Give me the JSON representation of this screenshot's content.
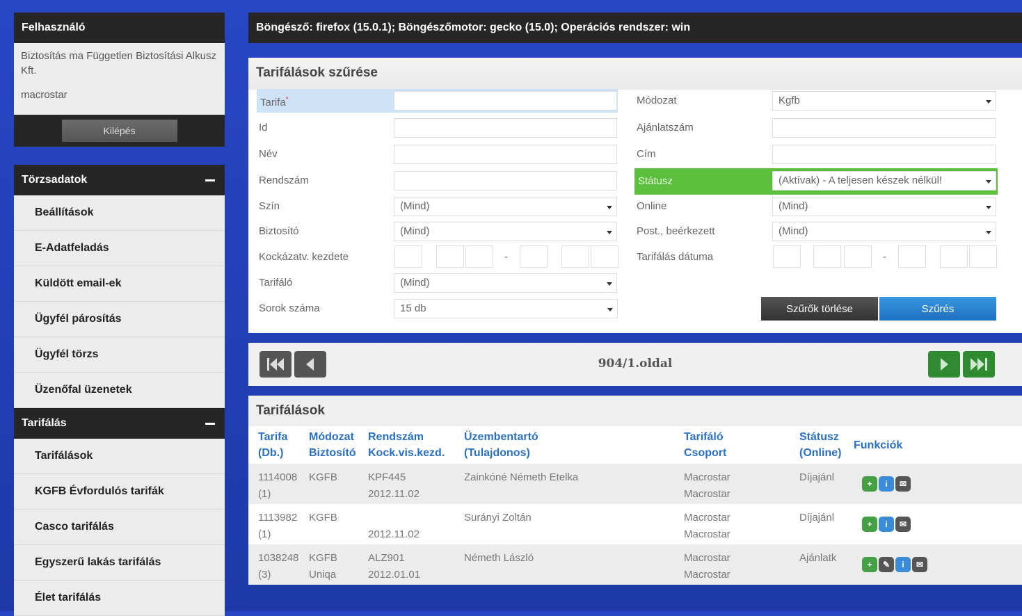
{
  "user_panel": {
    "title": "Felhasználó",
    "company": "Biztosítás ma Független Biztosítási Alkusz Kft.",
    "username": "macrostar",
    "logout_label": "Kilépés"
  },
  "sections": [
    {
      "title": "Törzsadatok",
      "items": [
        "Beállítások",
        "E-Adatfeladás",
        "Küldött email-ek",
        "Ügyfél párosítás",
        "Ügyfél törzs",
        "Üzenőfal üzenetek"
      ]
    },
    {
      "title": "Tarifálás",
      "items": [
        "Tarifálások",
        "KGFB Évfordulós tarifák",
        "Casco tarifálás",
        "Egyszerű lakás tarifálás",
        "Élet tarifálás"
      ]
    }
  ],
  "browser_info": "Böngésző: firefox (15.0.1); Böngészőmotor: gecko (15.0); Operációs rendszer: win",
  "filter": {
    "title": "Tarifálások szűrése",
    "labels": {
      "tarifa": "Tarifa",
      "required_mark": "*",
      "id": "Id",
      "nev": "Név",
      "rendszam": "Rendszám",
      "szin": "Szín",
      "biztosito": "Biztosító",
      "kockazat": "Kockázatv. kezdete",
      "tarifalo": "Tarifáló",
      "sorok": "Sorok száma",
      "modozat": "Módozat",
      "ajanlatszam": "Ajánlatszám",
      "cim": "Cím",
      "statusz": "Státusz",
      "online": "Online",
      "post": "Post., beérkezett",
      "tarifalas_datuma": "Tarifálás dátuma"
    },
    "values": {
      "szin": "(Mind)",
      "biztosito": "(Mind)",
      "tarifalo": "(Mind)",
      "sorok": "15 db",
      "modozat": "Kgfb",
      "statusz": "(Aktívak) - A teljesen készek nélkül!",
      "online": "(Mind)",
      "post": "(Mind)"
    },
    "clear_label": "Szűrők törlése",
    "filter_label": "Szűrés",
    "colors": {
      "focus": "#cfe3f8",
      "status_highlight": "#5cbf3d",
      "primary": "#2a7fd4"
    }
  },
  "pager": {
    "info": "904/1.oldal"
  },
  "list": {
    "title": "Tarifálások",
    "headers": [
      [
        "Tarifa",
        "(Db.)"
      ],
      [
        "Módozat",
        "Biztosító"
      ],
      [
        "Rendszám",
        "Kock.vis.kezd."
      ],
      [
        "Üzembentartó",
        "(Tulajdonos)"
      ],
      [
        "Tarifáló",
        "Csoport"
      ],
      [
        "Státusz",
        "(Online)"
      ],
      [
        "Funkciók",
        ""
      ]
    ],
    "rows": [
      {
        "c": [
          [
            "1114008",
            "(1)"
          ],
          [
            "KGFB",
            ""
          ],
          [
            "KPF445",
            "2012.11.02"
          ],
          [
            "Zainkóné Németh Etelka",
            ""
          ],
          [
            "Macrostar",
            "Macrostar"
          ],
          [
            "Díjajánl",
            ""
          ]
        ],
        "icons": [
          "plus",
          "info",
          "mail"
        ]
      },
      {
        "c": [
          [
            "1113982",
            "(1)"
          ],
          [
            "KGFB",
            ""
          ],
          [
            "",
            "2012.11.02"
          ],
          [
            "Surányi Zoltán",
            ""
          ],
          [
            "Macrostar",
            "Macrostar"
          ],
          [
            "Díjajánl",
            ""
          ]
        ],
        "icons": [
          "plus",
          "info",
          "mail"
        ]
      },
      {
        "c": [
          [
            "1038248",
            "(3)"
          ],
          [
            "KGFB",
            "Uniqa"
          ],
          [
            "ALZ901",
            "2012.01.01"
          ],
          [
            "Németh László",
            ""
          ],
          [
            "Macrostar",
            "Macrostar"
          ],
          [
            "Ajánlatk",
            ""
          ]
        ],
        "icons": [
          "plus",
          "edit",
          "info",
          "mail"
        ]
      }
    ]
  }
}
